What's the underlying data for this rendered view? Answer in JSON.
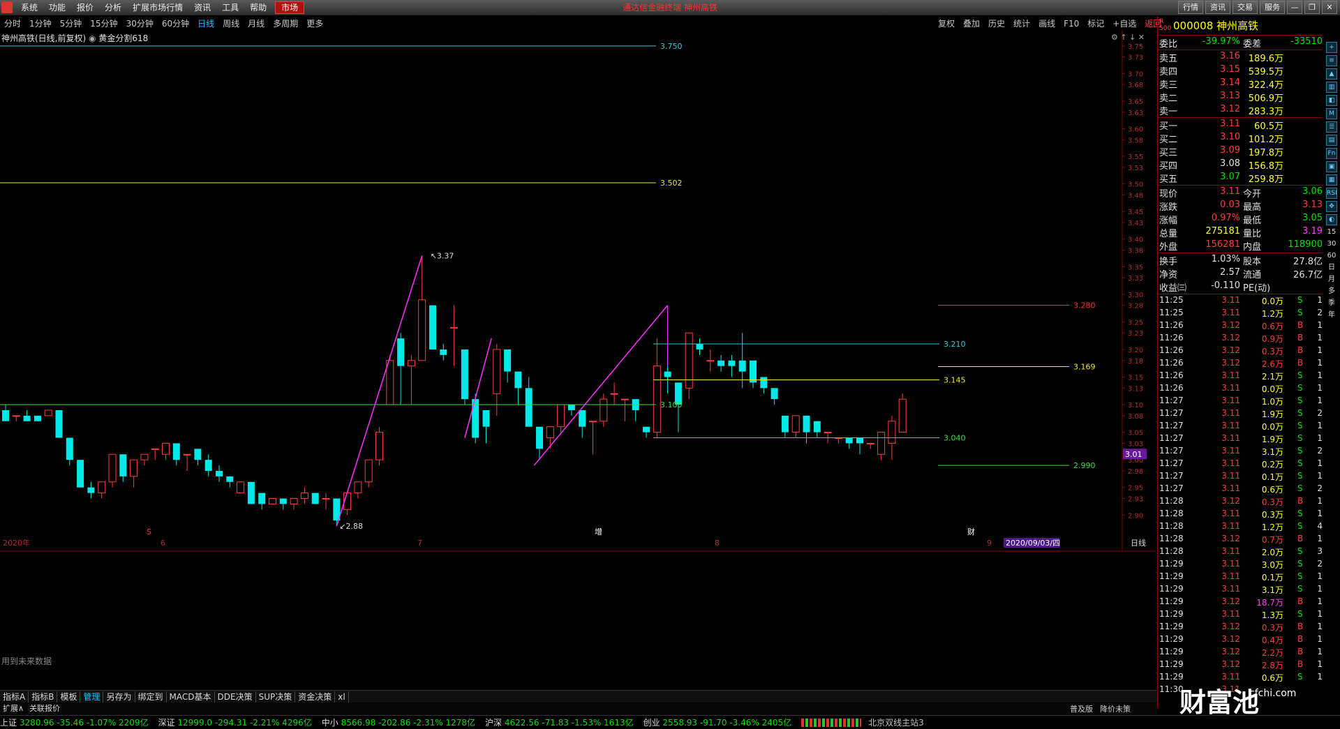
{
  "app": {
    "title": "通达信金融终端  神州高铁",
    "menu": [
      "系统",
      "功能",
      "报价",
      "分析",
      "扩展市场行情",
      "资讯",
      "工具",
      "帮助"
    ],
    "market_button": "市场",
    "right_buttons": [
      "行情",
      "资讯",
      "交易",
      "服务"
    ]
  },
  "toolbar": {
    "periods": [
      "分时",
      "1分钟",
      "5分钟",
      "15分钟",
      "30分钟",
      "60分钟",
      "日线",
      "周线",
      "月线",
      "多周期",
      "更多"
    ],
    "active_period": "日线",
    "right_items": [
      "复权",
      "叠加",
      "历史",
      "统计",
      "画线",
      "F10",
      "标记",
      "+自选",
      "返回"
    ]
  },
  "chart": {
    "title": "神州高铁(日线,前复权)",
    "indicator": "黄金分割618",
    "future_note": "用到未来数据",
    "price_label": "3.01",
    "period_label": "日线",
    "date_label": "2020/09/03/四",
    "x_labels": [
      "2020年",
      "6",
      "7",
      "8",
      "9"
    ],
    "markers": [
      {
        "text": "S",
        "color": "#ff3030"
      },
      {
        "text": "增",
        "color": "#fff"
      },
      {
        "text": "财",
        "color": "#fff"
      }
    ],
    "y_ticks": [
      "3.75",
      "3.73",
      "3.70",
      "3.68",
      "3.65",
      "3.63",
      "3.60",
      "3.58",
      "3.55",
      "3.53",
      "3.50",
      "3.48",
      "3.45",
      "3.43",
      "3.40",
      "3.38",
      "3.35",
      "3.33",
      "3.30",
      "3.28",
      "3.25",
      "3.23",
      "3.20",
      "3.18",
      "3.15",
      "3.13",
      "3.10",
      "3.08",
      "3.05",
      "3.03",
      "3.00",
      "2.98",
      "2.95",
      "2.93",
      "2.90"
    ],
    "fib_labels": [
      {
        "text": "3.750",
        "color": "#3cc8dc"
      },
      {
        "text": "3.502",
        "color": "#e8e830"
      },
      {
        "text": "3.100",
        "color": "#40e040"
      },
      {
        "text": "3.37",
        "color": "#ddd"
      },
      {
        "text": "2.88",
        "color": "#ddd"
      },
      {
        "text": "3.210",
        "color": "#3cc8dc"
      },
      {
        "text": "3.145",
        "color": "#e8e830"
      },
      {
        "text": "3.040",
        "color": "#40e040"
      },
      {
        "text": "3.280",
        "color": "#ff3030"
      },
      {
        "text": "3.169",
        "color": "#e8e830"
      },
      {
        "text": "2.990",
        "color": "#40e040"
      }
    ],
    "candles": [
      [
        3.09,
        3.07,
        3.1,
        3.07
      ],
      [
        3.08,
        3.08,
        3.08,
        3.07
      ],
      [
        3.08,
        3.07,
        3.09,
        3.07
      ],
      [
        3.08,
        3.07,
        3.08,
        3.07
      ],
      [
        3.08,
        3.09,
        3.09,
        3.08
      ],
      [
        3.09,
        3.04,
        3.09,
        3.04
      ],
      [
        3.04,
        3.0,
        3.04,
        2.99
      ],
      [
        3.0,
        2.95,
        3.0,
        2.95
      ],
      [
        2.95,
        2.94,
        2.96,
        2.93
      ],
      [
        2.94,
        2.96,
        2.96,
        2.93
      ],
      [
        2.96,
        3.01,
        3.01,
        2.95
      ],
      [
        3.01,
        2.97,
        3.01,
        2.96
      ],
      [
        2.97,
        3.0,
        3.0,
        2.95
      ],
      [
        3.0,
        3.01,
        3.01,
        2.99
      ],
      [
        3.02,
        3.02,
        3.02,
        3.0
      ],
      [
        3.01,
        3.03,
        3.03,
        3.0
      ],
      [
        3.03,
        3.0,
        3.03,
        2.99
      ],
      [
        3.01,
        3.01,
        3.01,
        2.98
      ],
      [
        3.02,
        3.0,
        3.02,
        2.99
      ],
      [
        3.0,
        2.98,
        3.01,
        2.97
      ],
      [
        2.98,
        2.97,
        2.99,
        2.96
      ],
      [
        2.97,
        2.96,
        2.97,
        2.95
      ],
      [
        2.94,
        2.96,
        2.96,
        2.94
      ],
      [
        2.96,
        2.92,
        2.96,
        2.92
      ],
      [
        2.94,
        2.92,
        2.94,
        2.91
      ],
      [
        2.92,
        2.93,
        2.93,
        2.92
      ],
      [
        2.93,
        2.92,
        2.93,
        2.91
      ],
      [
        2.92,
        2.93,
        2.93,
        2.91
      ],
      [
        2.93,
        2.94,
        2.95,
        2.92
      ],
      [
        2.94,
        2.92,
        2.94,
        2.92
      ],
      [
        2.93,
        2.93,
        2.94,
        2.91
      ],
      [
        2.93,
        2.89,
        2.93,
        2.88
      ],
      [
        2.91,
        2.94,
        2.94,
        2.9
      ],
      [
        2.94,
        2.96,
        2.96,
        2.93
      ],
      [
        2.96,
        3.0,
        3.0,
        2.95
      ],
      [
        3.0,
        3.05,
        3.06,
        2.99
      ],
      [
        3.1,
        3.18,
        3.19,
        3.1
      ],
      [
        3.22,
        3.17,
        3.23,
        3.1
      ],
      [
        3.17,
        3.18,
        3.19,
        3.1
      ],
      [
        3.18,
        3.29,
        3.37,
        3.18
      ],
      [
        3.28,
        3.2,
        3.28,
        3.2
      ],
      [
        3.2,
        3.19,
        3.21,
        3.18
      ],
      [
        3.24,
        3.24,
        3.28,
        3.17
      ],
      [
        3.2,
        3.11,
        3.2,
        3.1
      ],
      [
        3.11,
        3.04,
        3.12,
        3.03
      ],
      [
        3.09,
        3.06,
        3.09,
        3.03
      ],
      [
        3.12,
        3.2,
        3.21,
        3.08
      ],
      [
        3.2,
        3.16,
        3.2,
        3.14
      ],
      [
        3.16,
        3.13,
        3.16,
        3.1
      ],
      [
        3.13,
        3.06,
        3.15,
        3.06
      ],
      [
        3.06,
        3.02,
        3.06,
        3.0
      ],
      [
        3.04,
        3.06,
        3.06,
        3.02
      ],
      [
        3.06,
        3.1,
        3.1,
        3.05
      ],
      [
        3.1,
        3.09,
        3.1,
        3.08
      ],
      [
        3.09,
        3.06,
        3.09,
        3.04
      ],
      [
        3.07,
        3.07,
        3.07,
        3.01
      ],
      [
        3.07,
        3.11,
        3.12,
        3.06
      ],
      [
        3.12,
        3.12,
        3.14,
        3.1
      ],
      [
        3.11,
        3.11,
        3.11,
        3.07
      ],
      [
        3.11,
        3.09,
        3.11,
        3.07
      ],
      [
        3.06,
        3.05,
        3.06,
        3.04
      ],
      [
        3.05,
        3.17,
        3.22,
        3.04
      ],
      [
        3.16,
        3.15,
        3.2,
        3.12
      ],
      [
        3.14,
        3.1,
        3.14,
        3.05
      ],
      [
        3.13,
        3.23,
        3.23,
        3.11
      ],
      [
        3.21,
        3.2,
        3.22,
        3.19
      ],
      [
        3.18,
        3.18,
        3.2,
        3.16
      ],
      [
        3.18,
        3.17,
        3.19,
        3.16
      ],
      [
        3.18,
        3.17,
        3.19,
        3.15
      ],
      [
        3.18,
        3.16,
        3.23,
        3.13
      ],
      [
        3.18,
        3.14,
        3.18,
        3.13
      ],
      [
        3.15,
        3.13,
        3.15,
        3.12
      ],
      [
        3.13,
        3.11,
        3.13,
        3.1
      ],
      [
        3.08,
        3.05,
        3.08,
        3.04
      ],
      [
        3.05,
        3.08,
        3.08,
        3.04
      ],
      [
        3.08,
        3.05,
        3.08,
        3.03
      ],
      [
        3.07,
        3.05,
        3.07,
        3.04
      ],
      [
        3.05,
        3.05,
        3.05,
        3.03
      ],
      [
        3.04,
        3.04,
        3.04,
        3.03
      ],
      [
        3.04,
        3.03,
        3.04,
        3.02
      ],
      [
        3.04,
        3.03,
        3.04,
        3.01
      ],
      [
        3.03,
        3.03,
        3.03,
        3.02
      ],
      [
        3.01,
        3.05,
        3.05,
        3.0
      ],
      [
        3.03,
        3.07,
        3.08,
        3.0
      ],
      [
        3.05,
        3.11,
        3.12,
        3.05
      ]
    ]
  },
  "quote": {
    "code": "000008",
    "name": "神州高铁",
    "ratio_label": "委比",
    "ratio": "-39.97%",
    "diff_label": "委差",
    "diff": "-33510",
    "asks": [
      {
        "label": "卖五",
        "price": "3.16",
        "vol": "189.6万"
      },
      {
        "label": "卖四",
        "price": "3.15",
        "vol": "539.5万"
      },
      {
        "label": "卖三",
        "price": "3.14",
        "vol": "322.4万"
      },
      {
        "label": "卖二",
        "price": "3.13",
        "vol": "506.9万"
      },
      {
        "label": "卖一",
        "price": "3.12",
        "vol": "283.3万"
      }
    ],
    "bids": [
      {
        "label": "买一",
        "price": "3.11",
        "vol": "60.5万"
      },
      {
        "label": "买二",
        "price": "3.10",
        "vol": "101.2万"
      },
      {
        "label": "买三",
        "price": "3.09",
        "vol": "197.8万"
      },
      {
        "label": "买四",
        "price": "3.08",
        "vol": "156.8万"
      },
      {
        "label": "买五",
        "price": "3.07",
        "vol": "259.8万"
      }
    ],
    "stats": [
      [
        "现价",
        "3.11",
        "今开",
        "3.06"
      ],
      [
        "涨跌",
        "0.03",
        "最高",
        "3.13"
      ],
      [
        "涨幅",
        "0.97%",
        "最低",
        "3.05"
      ],
      [
        "总量",
        "275181",
        "量比",
        "3.19"
      ],
      [
        "外盘",
        "156281",
        "内盘",
        "118900"
      ],
      [
        "换手",
        "1.03%",
        "股本",
        "27.8亿"
      ],
      [
        "净资",
        "2.57",
        "流通",
        "26.7亿"
      ],
      [
        "收益㈢",
        "-0.110",
        "PE(动)",
        ""
      ]
    ],
    "ticks": [
      [
        "11:25",
        "3.11",
        "0.0万",
        "S",
        "1"
      ],
      [
        "11:25",
        "3.11",
        "1.2万",
        "S",
        "2"
      ],
      [
        "11:26",
        "3.12",
        "0.6万",
        "B",
        "1"
      ],
      [
        "11:26",
        "3.12",
        "0.9万",
        "B",
        "1"
      ],
      [
        "11:26",
        "3.12",
        "0.3万",
        "B",
        "1"
      ],
      [
        "11:26",
        "3.12",
        "2.6万",
        "B",
        "1"
      ],
      [
        "11:26",
        "3.11",
        "2.1万",
        "S",
        "1"
      ],
      [
        "11:26",
        "3.11",
        "0.0万",
        "S",
        "1"
      ],
      [
        "11:27",
        "3.11",
        "1.0万",
        "S",
        "1"
      ],
      [
        "11:27",
        "3.11",
        "1.9万",
        "S",
        "2"
      ],
      [
        "11:27",
        "3.11",
        "0.0万",
        "S",
        "1"
      ],
      [
        "11:27",
        "3.11",
        "1.9万",
        "S",
        "1"
      ],
      [
        "11:27",
        "3.11",
        "3.1万",
        "S",
        "2"
      ],
      [
        "11:27",
        "3.11",
        "0.2万",
        "S",
        "1"
      ],
      [
        "11:27",
        "3.11",
        "0.1万",
        "S",
        "1"
      ],
      [
        "11:27",
        "3.11",
        "0.6万",
        "S",
        "2"
      ],
      [
        "11:28",
        "3.12",
        "0.3万",
        "B",
        "1"
      ],
      [
        "11:28",
        "3.11",
        "0.3万",
        "S",
        "1"
      ],
      [
        "11:28",
        "3.11",
        "1.2万",
        "S",
        "4"
      ],
      [
        "11:28",
        "3.12",
        "0.7万",
        "B",
        "1"
      ],
      [
        "11:28",
        "3.11",
        "2.0万",
        "S",
        "3"
      ],
      [
        "11:29",
        "3.11",
        "3.0万",
        "S",
        "2"
      ],
      [
        "11:29",
        "3.11",
        "0.1万",
        "S",
        "1"
      ],
      [
        "11:29",
        "3.11",
        "3.1万",
        "S",
        "1"
      ],
      [
        "11:29",
        "3.12",
        "18.7万",
        "B",
        "1"
      ],
      [
        "11:29",
        "3.11",
        "1.3万",
        "S",
        "1"
      ],
      [
        "11:29",
        "3.12",
        "0.3万",
        "B",
        "1"
      ],
      [
        "11:29",
        "3.12",
        "0.4万",
        "B",
        "1"
      ],
      [
        "11:29",
        "3.12",
        "2.2万",
        "B",
        "1"
      ],
      [
        "11:29",
        "3.12",
        "2.8万",
        "B",
        "1"
      ],
      [
        "11:29",
        "3.11",
        "0.6万",
        "S",
        "1"
      ],
      [
        "11:30",
        "3.11",
        "",
        "",
        ""
      ]
    ]
  },
  "side_icons": [
    "+",
    "≡",
    "▲",
    "▥",
    "◧",
    "M",
    "☰",
    "▤",
    "Fn",
    "▣",
    "▦",
    "RSI",
    "✥",
    "◐"
  ],
  "side_text": [
    "15",
    "30",
    "60",
    "日",
    "月",
    "多",
    "季",
    "年"
  ],
  "tabs": [
    "指标A",
    "指标B",
    "模板",
    "管理",
    "另存为",
    "绑定到",
    "MACD基本",
    "DDE决策",
    "SUP决策",
    "资金决策",
    "xl"
  ],
  "active_tab": "管理",
  "tabs2": [
    "扩展∧",
    "关联报价"
  ],
  "tabs2_right": [
    "普及版",
    "降价未策"
  ],
  "status": [
    {
      "name": "上证",
      "value": "3280.96  -35.46  -1.07% 2209亿"
    },
    {
      "name": "深证",
      "value": "12999.0  -294.31  -2.21% 4296亿"
    },
    {
      "name": "中小",
      "value": "8566.98  -202.86  -2.31% 1278亿"
    },
    {
      "name": "沪深",
      "value": "4622.56  -71.83  -1.53% 1613亿"
    },
    {
      "name": "创业",
      "value": "2558.93  -91.70  -3.46% 2405亿"
    }
  ],
  "server": "北京双线主站3",
  "watermark": "财富池",
  "watermark_sub": "cfchi.com"
}
